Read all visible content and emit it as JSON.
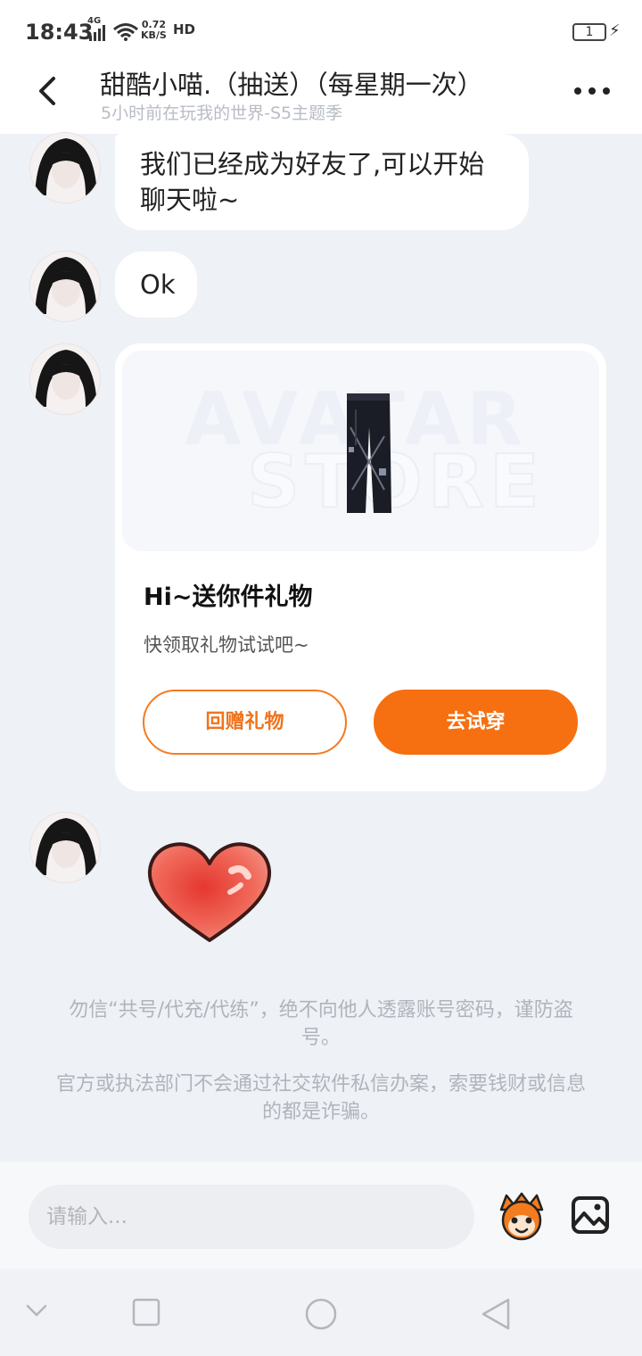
{
  "status_bar": {
    "time": "18:43",
    "network": "4G",
    "speed_value": "0.72",
    "speed_unit": "KB/S",
    "hd": "HD",
    "battery": "1"
  },
  "header": {
    "title": "甜酷小喵.（抽送）（每星期一次）",
    "subtitle": "5小时前在玩我的世界-S5主题季"
  },
  "messages": [
    {
      "text": "我们已经成为好友了,可以开始聊天啦~"
    },
    {
      "text": "Ok"
    }
  ],
  "gift_card": {
    "watermark_top": "AVATAR",
    "watermark_bottom": "STORE",
    "title": "Hi~送你件礼物",
    "description": "快领取礼物试试吧~",
    "return_button": "回赠礼物",
    "try_button": "去试穿"
  },
  "notices": [
    "勿信“共号/代充/代练”，绝不向他人透露账号密码，谨防盗号。",
    "官方或执法部门不会通过社交软件私信办案，索要钱财或信息的都是诈骗。"
  ],
  "input": {
    "placeholder": "请输入..."
  },
  "colors": {
    "accent": "#f66f10",
    "background": "#eef1f6"
  }
}
